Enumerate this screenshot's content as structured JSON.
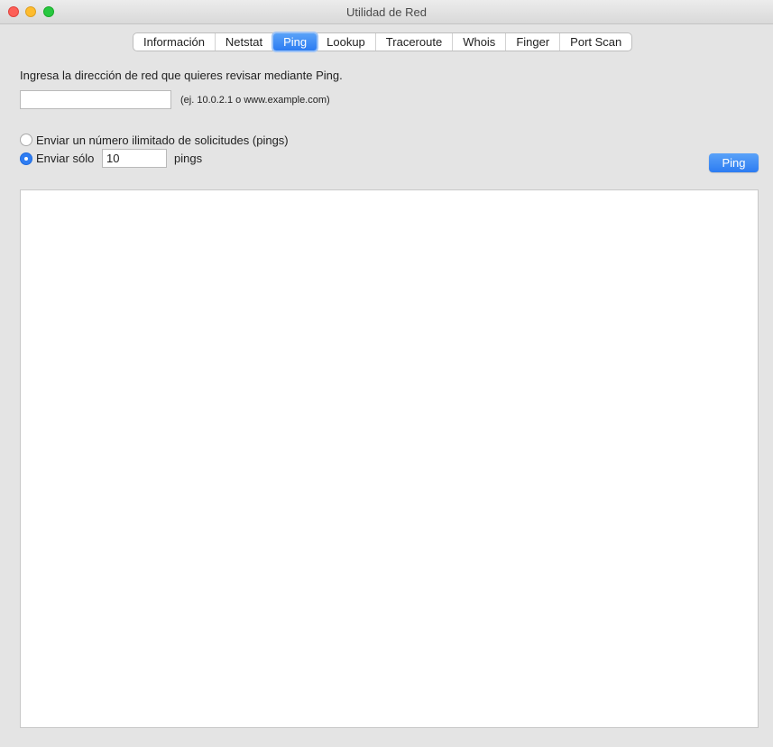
{
  "window": {
    "title": "Utilidad de Red"
  },
  "tabs": [
    {
      "label": "Información",
      "active": false
    },
    {
      "label": "Netstat",
      "active": false
    },
    {
      "label": "Ping",
      "active": true
    },
    {
      "label": "Lookup",
      "active": false
    },
    {
      "label": "Traceroute",
      "active": false
    },
    {
      "label": "Whois",
      "active": false
    },
    {
      "label": "Finger",
      "active": false
    },
    {
      "label": "Port Scan",
      "active": false
    }
  ],
  "ping": {
    "prompt": "Ingresa la dirección de red que quieres revisar mediante Ping.",
    "address_value": "",
    "address_hint": "(ej. 10.0.2.1 o www.example.com)",
    "option_unlimited": "Enviar un número ilimitado de solicitudes (pings)",
    "option_limited_prefix": "Enviar sólo",
    "count_value": "10",
    "option_limited_suffix": "pings",
    "selected_option": "limited",
    "button_label": "Ping",
    "output_text": ""
  },
  "colors": {
    "accent": "#2c7cf2",
    "window_bg": "#e4e4e4"
  }
}
